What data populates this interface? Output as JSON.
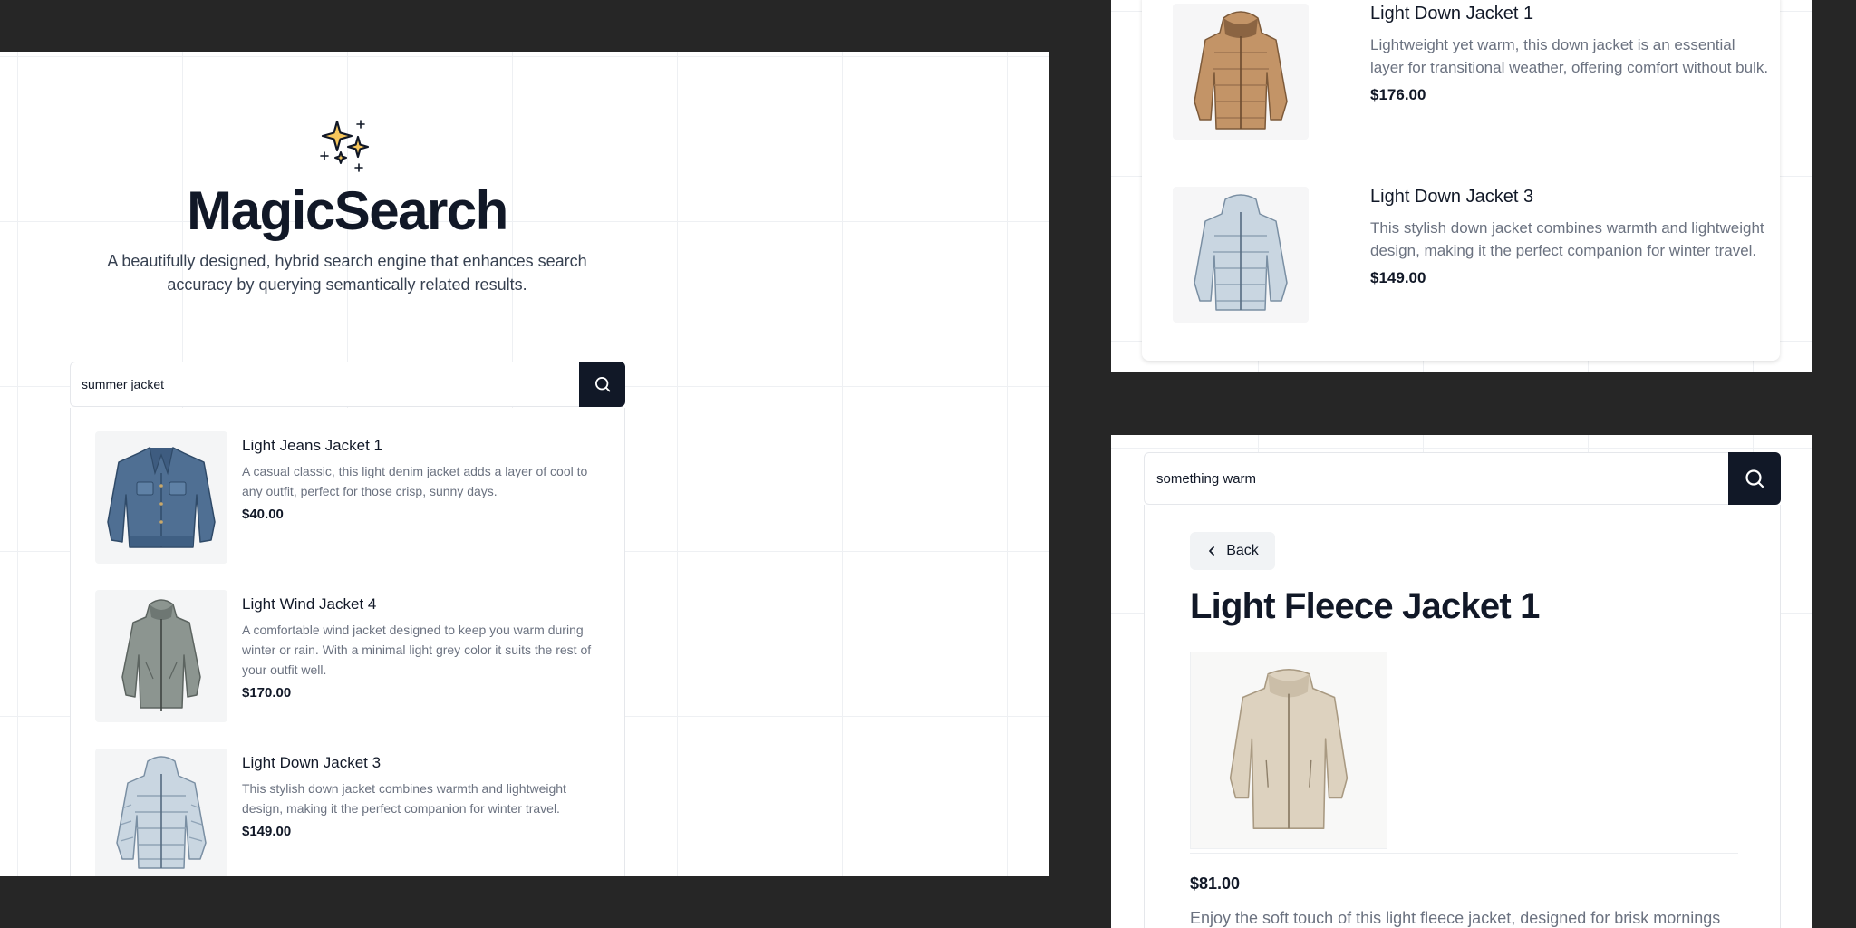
{
  "app": {
    "title": "MagicSearch",
    "subtitle": "A beautifully designed, hybrid search engine that enhances search accuracy by querying semantically related results."
  },
  "main_search": {
    "value": "summer jacket"
  },
  "main_results": [
    {
      "name": "Light Jeans Jacket 1",
      "description": "A casual classic, this light denim jacket adds a layer of cool to any outfit, perfect for those crisp, sunny days.",
      "price": "$40.00",
      "image": "denim-jacket-photo"
    },
    {
      "name": "Light Wind Jacket 4",
      "description": "A comfortable wind jacket designed to keep you warm during winter or rain. With a minimal light grey color it suits the rest of your outfit well.",
      "price": "$170.00",
      "image": "wind-jacket-photo"
    },
    {
      "name": "Light Down Jacket 3",
      "description": "This stylish down jacket combines warmth and lightweight design, making it the perfect companion for winter travel.",
      "price": "$149.00",
      "image": "down-jacket-photo"
    }
  ],
  "top_right_results": [
    {
      "name": "Light Down Jacket 1",
      "description": "Lightweight yet warm, this down jacket is an essential layer for transitional weather, offering comfort without bulk.",
      "price": "$176.00",
      "image": "tan-down-jacket-photo"
    },
    {
      "name": "Light Down Jacket 3",
      "description": "This stylish down jacket combines warmth and lightweight design, making it the perfect companion for winter travel.",
      "price": "$149.00",
      "image": "down-jacket-photo"
    }
  ],
  "detail_search": {
    "value": "something warm"
  },
  "detail": {
    "back_label": "Back",
    "title": "Light Fleece Jacket 1",
    "price": "$81.00",
    "description": "Enjoy the soft touch of this light fleece jacket, designed for brisk mornings",
    "image": "fleece-jacket-photo"
  },
  "colors": {
    "background": "#262626",
    "accent_dark": "#111827",
    "sparkle": "#f6c65b"
  }
}
